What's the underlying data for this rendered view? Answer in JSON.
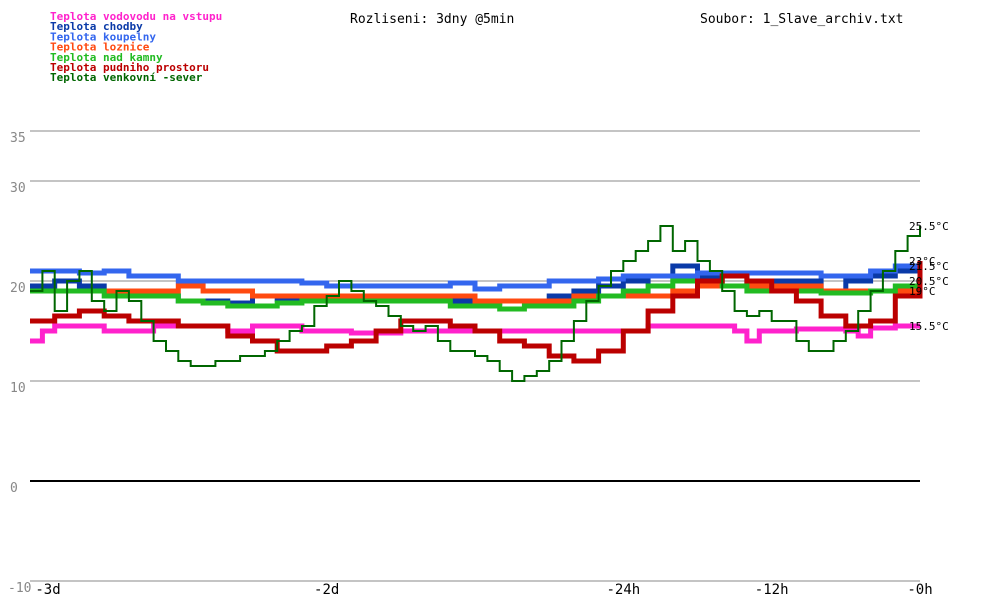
{
  "chart_data": {
    "type": "line",
    "resolution": "Rozliseni: 3dny @5min",
    "file": "Soubor: 1_Slave_archiv.txt",
    "ylim": [
      -10,
      35
    ],
    "y_ticks": [
      35,
      30,
      20,
      10,
      0,
      -10
    ],
    "x_ticks": [
      {
        "x": -72,
        "label": "-3d"
      },
      {
        "x": -48,
        "label": "-2d"
      },
      {
        "x": -24,
        "label": "-24h"
      },
      {
        "x": -12,
        "label": "-12h"
      },
      {
        "x": 0,
        "label": "-0h"
      }
    ],
    "xlim": [
      -72,
      0
    ],
    "grid": true,
    "legend_position": "top-left",
    "series": [
      {
        "name": "Teplota vodovodu na vstupu",
        "color": "#ff22cc",
        "width": 5,
        "end_label": "15.5°C",
        "points": [
          [
            -72,
            14
          ],
          [
            -71,
            15
          ],
          [
            -70,
            15.5
          ],
          [
            -66,
            15
          ],
          [
            -62,
            15.5
          ],
          [
            -60,
            15.5
          ],
          [
            -56,
            15
          ],
          [
            -54,
            15.5
          ],
          [
            -50,
            15
          ],
          [
            -46,
            14.8
          ],
          [
            -42,
            15
          ],
          [
            -38,
            15
          ],
          [
            -34,
            15
          ],
          [
            -30,
            15
          ],
          [
            -26,
            15
          ],
          [
            -22,
            15.5
          ],
          [
            -18,
            15.5
          ],
          [
            -16,
            15.5
          ],
          [
            -15,
            15
          ],
          [
            -14,
            14
          ],
          [
            -13,
            15
          ],
          [
            -10,
            15.2
          ],
          [
            -6,
            15
          ],
          [
            -5,
            14.5
          ],
          [
            -4,
            15.3
          ],
          [
            -2,
            15.5
          ],
          [
            0,
            15.5
          ]
        ]
      },
      {
        "name": "Teplota chodby",
        "color": "#0a3aa8",
        "width": 5,
        "end_label": "",
        "points": [
          [
            -72,
            19.5
          ],
          [
            -70,
            20
          ],
          [
            -68,
            19.5
          ],
          [
            -66,
            19
          ],
          [
            -64,
            18.8
          ],
          [
            -62,
            18.5
          ],
          [
            -60,
            18
          ],
          [
            -58,
            18
          ],
          [
            -56,
            17.8
          ],
          [
            -54,
            18.5
          ],
          [
            -52,
            18.2
          ],
          [
            -50,
            18.5
          ],
          [
            -48,
            18.5
          ],
          [
            -46,
            18.5
          ],
          [
            -44,
            18.5
          ],
          [
            -42,
            18.5
          ],
          [
            -40,
            18.5
          ],
          [
            -38,
            18
          ],
          [
            -36,
            17.8
          ],
          [
            -34,
            18
          ],
          [
            -32,
            18
          ],
          [
            -30,
            18.5
          ],
          [
            -28,
            19
          ],
          [
            -26,
            19.5
          ],
          [
            -24,
            20
          ],
          [
            -22,
            20.5
          ],
          [
            -20,
            21.5
          ],
          [
            -18,
            20.5
          ],
          [
            -16,
            20.5
          ],
          [
            -14,
            20
          ],
          [
            -12,
            20
          ],
          [
            -10,
            20
          ],
          [
            -8,
            19
          ],
          [
            -6,
            20
          ],
          [
            -4,
            20.5
          ],
          [
            -2,
            21
          ],
          [
            0,
            20.5
          ]
        ]
      },
      {
        "name": "Teplota koupelny",
        "color": "#3366ee",
        "width": 5,
        "end_label": "21.5°C",
        "points": [
          [
            -72,
            21
          ],
          [
            -70,
            21
          ],
          [
            -68,
            20.8
          ],
          [
            -66,
            21
          ],
          [
            -64,
            20.5
          ],
          [
            -62,
            20.5
          ],
          [
            -60,
            20
          ],
          [
            -58,
            20
          ],
          [
            -56,
            20
          ],
          [
            -54,
            20
          ],
          [
            -52,
            20
          ],
          [
            -50,
            19.8
          ],
          [
            -48,
            19.5
          ],
          [
            -46,
            19.5
          ],
          [
            -44,
            19.5
          ],
          [
            -42,
            19.5
          ],
          [
            -40,
            19.5
          ],
          [
            -38,
            19.8
          ],
          [
            -36,
            19.2
          ],
          [
            -34,
            19.5
          ],
          [
            -32,
            19.5
          ],
          [
            -30,
            20
          ],
          [
            -28,
            20
          ],
          [
            -26,
            20.2
          ],
          [
            -24,
            20.5
          ],
          [
            -22,
            20.5
          ],
          [
            -20,
            20.5
          ],
          [
            -18,
            20.8
          ],
          [
            -16,
            20.8
          ],
          [
            -14,
            20.8
          ],
          [
            -12,
            20.8
          ],
          [
            -10,
            20.8
          ],
          [
            -8,
            20.5
          ],
          [
            -6,
            20.5
          ],
          [
            -4,
            21
          ],
          [
            -2,
            21.5
          ],
          [
            0,
            21.5
          ]
        ]
      },
      {
        "name": "Teplota loznice",
        "color": "#ff4a10",
        "width": 5,
        "end_label": "19°C",
        "points": [
          [
            -72,
            19
          ],
          [
            -70,
            19
          ],
          [
            -68,
            19
          ],
          [
            -66,
            19
          ],
          [
            -64,
            19
          ],
          [
            -62,
            19
          ],
          [
            -60,
            19.5
          ],
          [
            -58,
            19
          ],
          [
            -56,
            19
          ],
          [
            -54,
            18.5
          ],
          [
            -52,
            18.5
          ],
          [
            -50,
            18.5
          ],
          [
            -48,
            18.5
          ],
          [
            -46,
            18.5
          ],
          [
            -44,
            18.5
          ],
          [
            -42,
            18.5
          ],
          [
            -40,
            18.5
          ],
          [
            -38,
            18.5
          ],
          [
            -36,
            18
          ],
          [
            -34,
            18
          ],
          [
            -32,
            18
          ],
          [
            -30,
            18
          ],
          [
            -28,
            18.5
          ],
          [
            -26,
            18.5
          ],
          [
            -24,
            18.5
          ],
          [
            -22,
            18.5
          ],
          [
            -20,
            19
          ],
          [
            -18,
            19.5
          ],
          [
            -16,
            19.5
          ],
          [
            -14,
            19.5
          ],
          [
            -12,
            19.5
          ],
          [
            -10,
            19.5
          ],
          [
            -8,
            19
          ],
          [
            -6,
            19
          ],
          [
            -4,
            19
          ],
          [
            -2,
            19
          ],
          [
            0,
            19
          ]
        ]
      },
      {
        "name": "Teplota nad kamny",
        "color": "#22bb22",
        "width": 5,
        "end_label": "20.5°C",
        "points": [
          [
            -72,
            19
          ],
          [
            -70,
            19
          ],
          [
            -68,
            19
          ],
          [
            -66,
            18.5
          ],
          [
            -64,
            18.5
          ],
          [
            -62,
            18.5
          ],
          [
            -60,
            18
          ],
          [
            -58,
            17.8
          ],
          [
            -56,
            17.5
          ],
          [
            -54,
            17.5
          ],
          [
            -52,
            17.8
          ],
          [
            -50,
            18
          ],
          [
            -48,
            18
          ],
          [
            -46,
            18
          ],
          [
            -44,
            18
          ],
          [
            -42,
            18
          ],
          [
            -40,
            18
          ],
          [
            -38,
            17.5
          ],
          [
            -36,
            17.5
          ],
          [
            -34,
            17.2
          ],
          [
            -32,
            17.5
          ],
          [
            -30,
            17.5
          ],
          [
            -28,
            18
          ],
          [
            -26,
            18.5
          ],
          [
            -24,
            19
          ],
          [
            -22,
            19.5
          ],
          [
            -20,
            20
          ],
          [
            -18,
            20
          ],
          [
            -16,
            19.5
          ],
          [
            -14,
            19
          ],
          [
            -12,
            19
          ],
          [
            -10,
            19
          ],
          [
            -8,
            18.8
          ],
          [
            -6,
            18.8
          ],
          [
            -4,
            19
          ],
          [
            -2,
            19.5
          ],
          [
            0,
            20
          ]
        ]
      },
      {
        "name": "Teplota pudniho prostoru",
        "color": "#bb0000",
        "width": 5,
        "end_label": "23°C",
        "points": [
          [
            -72,
            16
          ],
          [
            -70,
            16.5
          ],
          [
            -68,
            17
          ],
          [
            -66,
            16.5
          ],
          [
            -64,
            16
          ],
          [
            -62,
            16
          ],
          [
            -60,
            15.5
          ],
          [
            -58,
            15.5
          ],
          [
            -56,
            14.5
          ],
          [
            -54,
            14
          ],
          [
            -52,
            13
          ],
          [
            -50,
            13
          ],
          [
            -48,
            13.5
          ],
          [
            -46,
            14
          ],
          [
            -44,
            15
          ],
          [
            -42,
            16
          ],
          [
            -40,
            16
          ],
          [
            -38,
            15.5
          ],
          [
            -36,
            15
          ],
          [
            -34,
            14
          ],
          [
            -32,
            13.5
          ],
          [
            -30,
            12.5
          ],
          [
            -28,
            12
          ],
          [
            -26,
            13
          ],
          [
            -24,
            15
          ],
          [
            -22,
            17
          ],
          [
            -20,
            18.5
          ],
          [
            -18,
            20
          ],
          [
            -16,
            20.5
          ],
          [
            -14,
            20
          ],
          [
            -12,
            19
          ],
          [
            -10,
            18
          ],
          [
            -8,
            16.5
          ],
          [
            -6,
            15.5
          ],
          [
            -4,
            16
          ],
          [
            -2,
            18.5
          ],
          [
            0,
            22
          ]
        ]
      },
      {
        "name": "Teplota venkovní -sever",
        "color": "#006600",
        "width": 2,
        "end_label": "25.5°C",
        "points": [
          [
            -72,
            19
          ],
          [
            -71,
            21
          ],
          [
            -70,
            17
          ],
          [
            -69,
            20
          ],
          [
            -68,
            21
          ],
          [
            -67,
            18
          ],
          [
            -66,
            17
          ],
          [
            -65,
            19
          ],
          [
            -64,
            18
          ],
          [
            -63,
            16
          ],
          [
            -62,
            14
          ],
          [
            -61,
            13
          ],
          [
            -60,
            12
          ],
          [
            -59,
            11.5
          ],
          [
            -58,
            11.5
          ],
          [
            -57,
            12
          ],
          [
            -56,
            12
          ],
          [
            -55,
            12.5
          ],
          [
            -54,
            12.5
          ],
          [
            -53,
            13
          ],
          [
            -52,
            14
          ],
          [
            -51,
            15
          ],
          [
            -50,
            15.5
          ],
          [
            -49,
            17.5
          ],
          [
            -48,
            18.5
          ],
          [
            -47,
            20
          ],
          [
            -46,
            19
          ],
          [
            -45,
            18
          ],
          [
            -44,
            17.5
          ],
          [
            -43,
            16.5
          ],
          [
            -42,
            15.5
          ],
          [
            -41,
            15
          ],
          [
            -40,
            15.5
          ],
          [
            -39,
            14
          ],
          [
            -38,
            13
          ],
          [
            -37,
            13
          ],
          [
            -36,
            12.5
          ],
          [
            -35,
            12
          ],
          [
            -34,
            11
          ],
          [
            -33,
            10
          ],
          [
            -32,
            10.5
          ],
          [
            -31,
            11
          ],
          [
            -30,
            12
          ],
          [
            -29,
            14
          ],
          [
            -28,
            16
          ],
          [
            -27,
            18
          ],
          [
            -26,
            19.5
          ],
          [
            -25,
            21
          ],
          [
            -24,
            22
          ],
          [
            -23,
            23
          ],
          [
            -22,
            24
          ],
          [
            -21,
            25.5
          ],
          [
            -20,
            23
          ],
          [
            -19,
            24
          ],
          [
            -18,
            22
          ],
          [
            -17,
            21
          ],
          [
            -16,
            19
          ],
          [
            -15,
            17
          ],
          [
            -14,
            16.5
          ],
          [
            -13,
            17
          ],
          [
            -12,
            16
          ],
          [
            -11,
            16
          ],
          [
            -10,
            14
          ],
          [
            -9,
            13
          ],
          [
            -8,
            13
          ],
          [
            -7,
            14
          ],
          [
            -6,
            15
          ],
          [
            -5,
            17
          ],
          [
            -4,
            19
          ],
          [
            -3,
            21
          ],
          [
            -2,
            23
          ],
          [
            -1,
            24.5
          ],
          [
            0,
            25.5
          ]
        ]
      }
    ],
    "legend": [
      {
        "label": "Teplota vodovodu na vstupu",
        "color": "#ff22cc"
      },
      {
        "label": "Teplota chodby",
        "color": "#0a3aa8"
      },
      {
        "label": "Teplota koupelny",
        "color": "#3366ee"
      },
      {
        "label": "Teplota loznice",
        "color": "#ff4a10"
      },
      {
        "label": "Teplota nad kamny",
        "color": "#22bb22"
      },
      {
        "label": "Teplota pudniho prostoru",
        "color": "#bb0000"
      },
      {
        "label": "Teplota venkovní -sever",
        "color": "#006600"
      }
    ]
  }
}
